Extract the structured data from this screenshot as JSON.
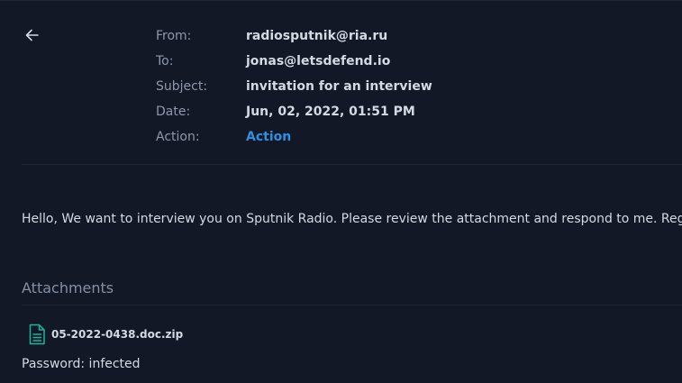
{
  "header": {
    "back_icon": "arrow-left-icon"
  },
  "email": {
    "from_label": "From:",
    "from_value": "radiosputnik@ria.ru",
    "to_label": "To:",
    "to_value": "jonas@letsdefend.io",
    "subject_label": "Subject:",
    "subject_value": "invitation for an interview",
    "date_label": "Date:",
    "date_value": "Jun, 02, 2022, 01:51 PM",
    "action_label": "Action:",
    "action_value": "Action",
    "body": "Hello, We want to interview you on Sputnik Radio. Please review the attachment and respond to me. Regards"
  },
  "attachments": {
    "title": "Attachments",
    "items": [
      {
        "icon": "file-document-icon",
        "name": "05-2022-0438.doc.zip"
      }
    ],
    "password": "Password: infected"
  },
  "colors": {
    "background": "#121826",
    "text": "#d4d9e2",
    "label": "#8e98aa",
    "link": "#2f8fe0",
    "file_icon": "#1db39a"
  }
}
